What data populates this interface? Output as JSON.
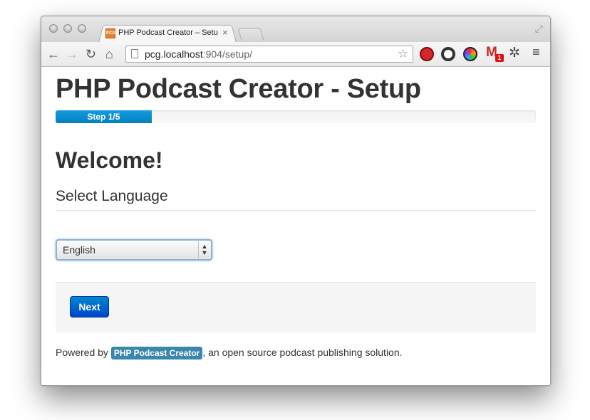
{
  "browser": {
    "tab_title": "PHP Podcast Creator – Setup",
    "favicon_text": "PCG",
    "url_host": "pcg.localhost",
    "url_rest": ":904/setup/",
    "gmail_count": "1"
  },
  "page": {
    "title": "PHP Podcast Creator - Setup",
    "progress_label": "Step 1/5",
    "progress_fraction": 0.2,
    "welcome": "Welcome!",
    "section_title": "Select Language",
    "language_selected": "English",
    "next_label": "Next",
    "footer_prefix": "Powered by",
    "footer_link": "PHP Podcast Creator",
    "footer_suffix": ", an open source podcast publishing solution."
  },
  "colors": {
    "progress": "#149bdf",
    "button": "#0044cc",
    "label": "#3a87ad"
  }
}
